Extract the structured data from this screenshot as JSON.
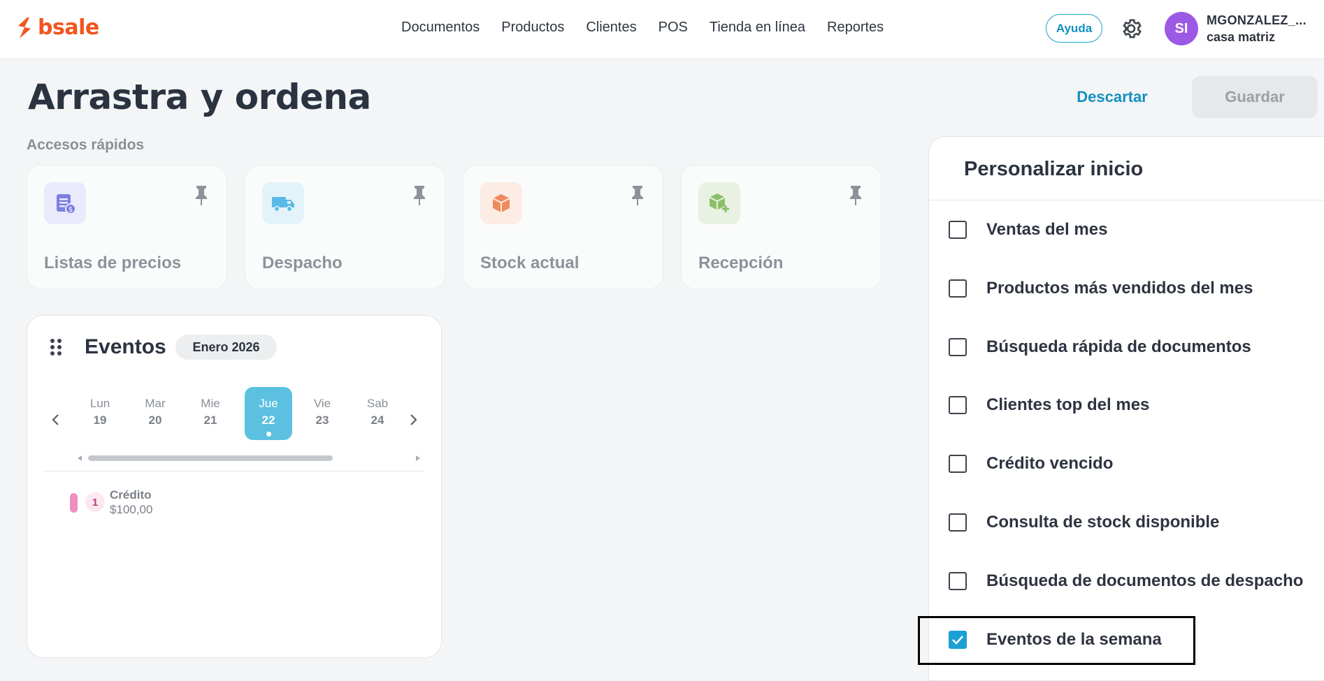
{
  "brand": {
    "name": "bsale",
    "color": "#f2551e"
  },
  "nav": {
    "items": [
      "Documentos",
      "Productos",
      "Clientes",
      "POS",
      "Tienda en línea",
      "Reportes"
    ]
  },
  "header": {
    "help_label": "Ayuda",
    "avatar_initials": "SI",
    "user_name": "MGONZALEZ_...",
    "branch": "casa matriz"
  },
  "page": {
    "title": "Arrastra y ordena",
    "discard_label": "Descartar",
    "save_label": "Guardar"
  },
  "quick_access": {
    "label": "Accesos rápidos",
    "cards": [
      {
        "label": "Listas de precios",
        "icon": "price-list-icon",
        "color": "#7b7fe0"
      },
      {
        "label": "Despacho",
        "icon": "truck-icon",
        "color": "#5ab9e6"
      },
      {
        "label": "Stock actual",
        "icon": "box-icon",
        "color": "#f08a5d"
      },
      {
        "label": "Recepción",
        "icon": "box-add-icon",
        "color": "#8bbf6a"
      }
    ]
  },
  "events": {
    "title": "Eventos",
    "month": "Enero 2026",
    "days": [
      {
        "name": "Lun",
        "num": "19"
      },
      {
        "name": "Mar",
        "num": "20"
      },
      {
        "name": "Mie",
        "num": "21"
      },
      {
        "name": "Jue",
        "num": "22",
        "active": true
      },
      {
        "name": "Vie",
        "num": "23"
      },
      {
        "name": "Sab",
        "num": "24"
      }
    ],
    "items": [
      {
        "count": "1",
        "name": "Crédito",
        "amount": "$100,00"
      }
    ]
  },
  "panel": {
    "title": "Personalizar inicio",
    "options": [
      {
        "label": "Ventas del mes",
        "checked": false
      },
      {
        "label": "Productos más vendidos del mes",
        "checked": false
      },
      {
        "label": "Búsqueda rápida de documentos",
        "checked": false
      },
      {
        "label": "Clientes top del mes",
        "checked": false
      },
      {
        "label": "Crédito vencido",
        "checked": false
      },
      {
        "label": "Consulta de stock disponible",
        "checked": false
      },
      {
        "label": "Búsqueda de documentos de despacho",
        "checked": false
      },
      {
        "label": "Eventos de la semana",
        "checked": true
      }
    ]
  }
}
